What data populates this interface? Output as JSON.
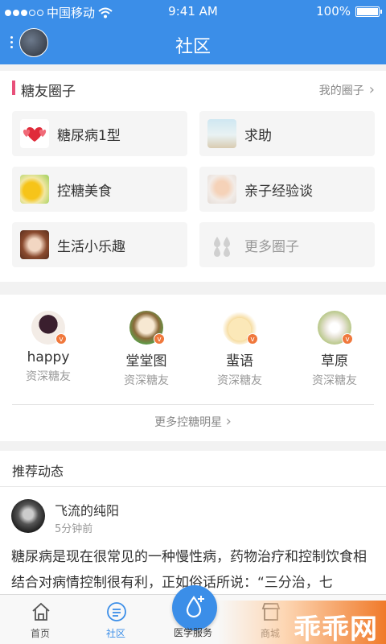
{
  "status_bar": {
    "carrier": "中国移动",
    "time": "9:41 AM",
    "battery": "100%"
  },
  "nav": {
    "title": "社区"
  },
  "circles": {
    "title": "糖友圈子",
    "more": "我的圈子",
    "items": [
      {
        "label": "糖尿病1型"
      },
      {
        "label": "求助"
      },
      {
        "label": "控糖美食"
      },
      {
        "label": "亲子经验谈"
      },
      {
        "label": "生活小乐趣"
      },
      {
        "label": "更多圈子"
      }
    ]
  },
  "stars": {
    "items": [
      {
        "name": "happy",
        "role": "资深糖友",
        "badge": "v"
      },
      {
        "name": "堂堂图",
        "role": "资深糖友",
        "badge": "v"
      },
      {
        "name": "蜚语",
        "role": "资深糖友",
        "badge": "v"
      },
      {
        "name": "草原",
        "role": "资深糖友",
        "badge": "v"
      }
    ],
    "more": "更多控糖明星"
  },
  "feed": {
    "title": "推荐动态",
    "post": {
      "author": "飞流的纯阳",
      "time": "5分钟前",
      "body": "糖尿病是现在很常见的一种慢性病，药物治疗和控制饮食相结合对病情控制很有利，正如俗话所说：“三分治，七"
    }
  },
  "tabbar": {
    "tabs": [
      {
        "label": "首页"
      },
      {
        "label": "社区"
      },
      {
        "label": "医学服务"
      },
      {
        "label": "商城"
      }
    ]
  },
  "watermark": {
    "text": "乖乖网"
  },
  "colors": {
    "primary": "#3b8ee8",
    "accent_bar": "#e8507a",
    "badge": "#f0783c"
  }
}
